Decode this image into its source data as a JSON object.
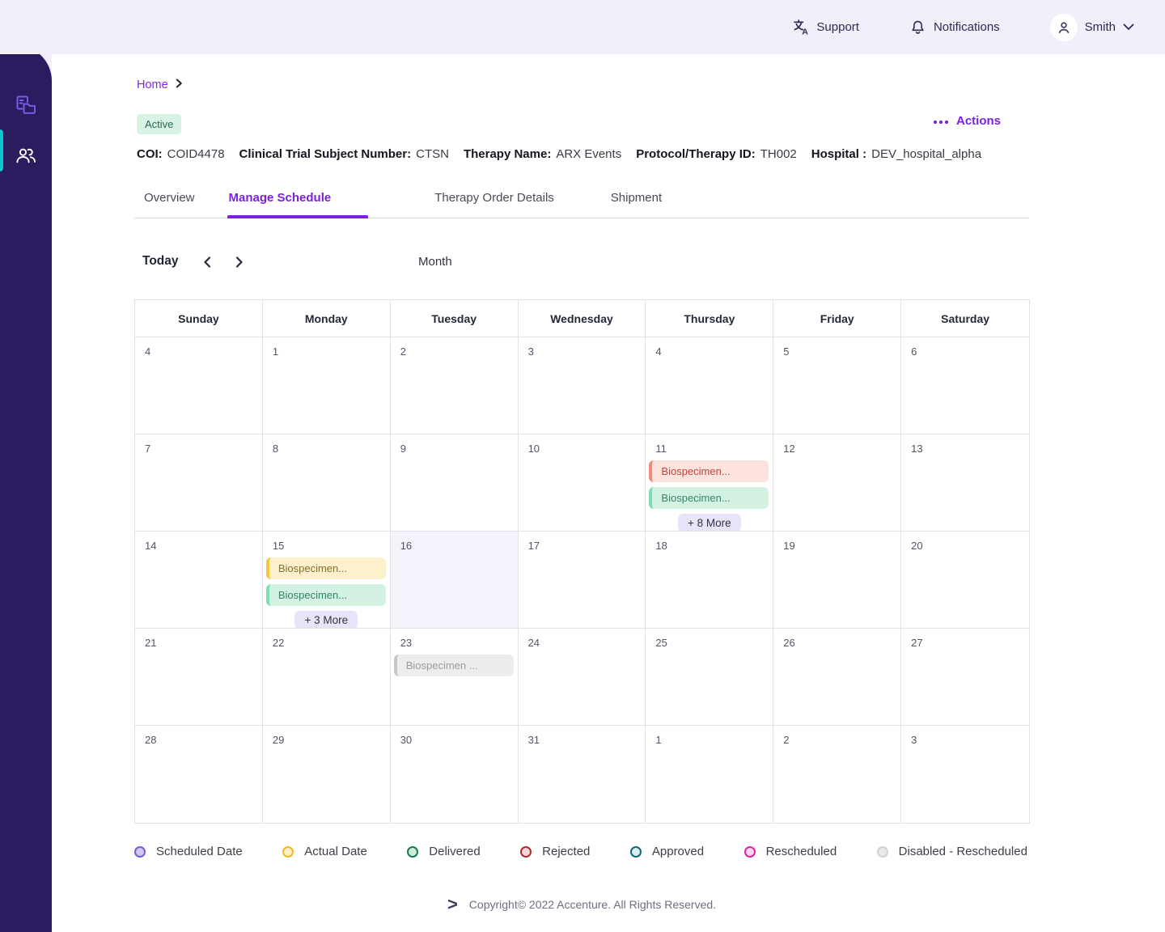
{
  "colors": {
    "accent": "#7b1fe0",
    "topbar_bg": "#f2effb",
    "sidebar_bg": "#2a1c5e",
    "sidebar_active": "#0bc5cf",
    "sidebar_icon": "#7e5bef",
    "badge_bg": "#d8f2e4",
    "badge_text": "#2d6a4f",
    "grid_border": "#e2e2e6",
    "today_bg": "#f5f2fc",
    "more_bg": "#e9e4f9"
  },
  "topbar": {
    "support_label": "Support",
    "notifications_label": "Notifications",
    "user_name": "Smith"
  },
  "breadcrumb": {
    "home": "Home"
  },
  "header": {
    "status_badge": "Active",
    "fields": [
      {
        "label": "COI:",
        "value": "COID4478"
      },
      {
        "label": "Clinical Trial Subject Number:",
        "value": "CTSN"
      },
      {
        "label": "Therapy Name:",
        "value": "ARX Events"
      },
      {
        "label": "Protocol/Therapy ID:",
        "value": "TH002"
      },
      {
        "label": "Hospital :",
        "value": "DEV_hospital_alpha"
      }
    ],
    "actions_label": "Actions"
  },
  "tabs": [
    {
      "label": "Overview",
      "active": false
    },
    {
      "label": "Manage Schedule",
      "active": true
    },
    {
      "label": "Therapy Order Details",
      "active": false
    },
    {
      "label": "Shipment",
      "active": false
    }
  ],
  "toolbar": {
    "today_label": "Today",
    "view_label": "Month"
  },
  "calendar": {
    "weekdays": [
      "Sunday",
      "Monday",
      "Tuesday",
      "Wednesday",
      "Thursday",
      "Friday",
      "Saturday"
    ],
    "event_styles": {
      "rejected": {
        "bg": "#fce3dd",
        "border": "#f28b7d",
        "text": "#bf4538"
      },
      "delivered": {
        "bg": "#d3f2e2",
        "border": "#7ddcb3",
        "text": "#35836a"
      },
      "actual": {
        "bg": "#fdf1cd",
        "border": "#f3c73b",
        "text": "#85702e"
      },
      "disabled": {
        "bg": "#ededee",
        "border": "#c7c7c9",
        "text": "#9b9ba0"
      }
    },
    "weeks": [
      {
        "days": [
          {
            "num": "4"
          },
          {
            "num": "1"
          },
          {
            "num": "2"
          },
          {
            "num": "3"
          },
          {
            "num": "4"
          },
          {
            "num": "5"
          },
          {
            "num": "6"
          }
        ]
      },
      {
        "days": [
          {
            "num": "7"
          },
          {
            "num": "8"
          },
          {
            "num": "9"
          },
          {
            "num": "10"
          },
          {
            "num": "11",
            "events": [
              {
                "label": "Biospecimen...",
                "type": "rejected"
              },
              {
                "label": "Biospecimen...",
                "type": "delivered"
              }
            ],
            "more": "+ 8 More"
          },
          {
            "num": "12"
          },
          {
            "num": "13"
          }
        ]
      },
      {
        "days": [
          {
            "num": "14"
          },
          {
            "num": "15",
            "events": [
              {
                "label": "Biospecimen...",
                "type": "actual"
              },
              {
                "label": "Biospecimen...",
                "type": "delivered"
              }
            ],
            "more": "+ 3 More"
          },
          {
            "num": "16",
            "today": true
          },
          {
            "num": "17"
          },
          {
            "num": "18"
          },
          {
            "num": "19"
          },
          {
            "num": "20"
          }
        ]
      },
      {
        "days": [
          {
            "num": "21"
          },
          {
            "num": "22"
          },
          {
            "num": "23",
            "events": [
              {
                "label": "Biospecimen ...",
                "type": "disabled"
              }
            ]
          },
          {
            "num": "24"
          },
          {
            "num": "25"
          },
          {
            "num": "26"
          },
          {
            "num": "27"
          }
        ]
      },
      {
        "days": [
          {
            "num": "28"
          },
          {
            "num": "29"
          },
          {
            "num": "30"
          },
          {
            "num": "31"
          },
          {
            "num": "1"
          },
          {
            "num": "2"
          },
          {
            "num": "3"
          }
        ]
      }
    ]
  },
  "legend": [
    {
      "label": "Scheduled Date",
      "ring": "#7a5cd0",
      "fill": "#d2c6f2"
    },
    {
      "label": "Actual Date",
      "ring": "#f2b824",
      "fill": "#fdeec9"
    },
    {
      "label": "Delivered",
      "ring": "#177a4c",
      "fill": "#cdebd9"
    },
    {
      "label": "Rejected",
      "ring": "#b02a37",
      "fill": "#f6d7da"
    },
    {
      "label": "Approved",
      "ring": "#0e6b78",
      "fill": "#dceef1"
    },
    {
      "label": "Rescheduled",
      "ring": "#e321a5",
      "fill": "#fad7ee"
    },
    {
      "label": "Disabled - Rescheduled",
      "ring": "#d2d2d2",
      "fill": "#eaeaea"
    }
  ],
  "footer": {
    "logo_glyph": ">",
    "copyright": "Copyright© 2022 Accenture. All Rights Reserved."
  }
}
